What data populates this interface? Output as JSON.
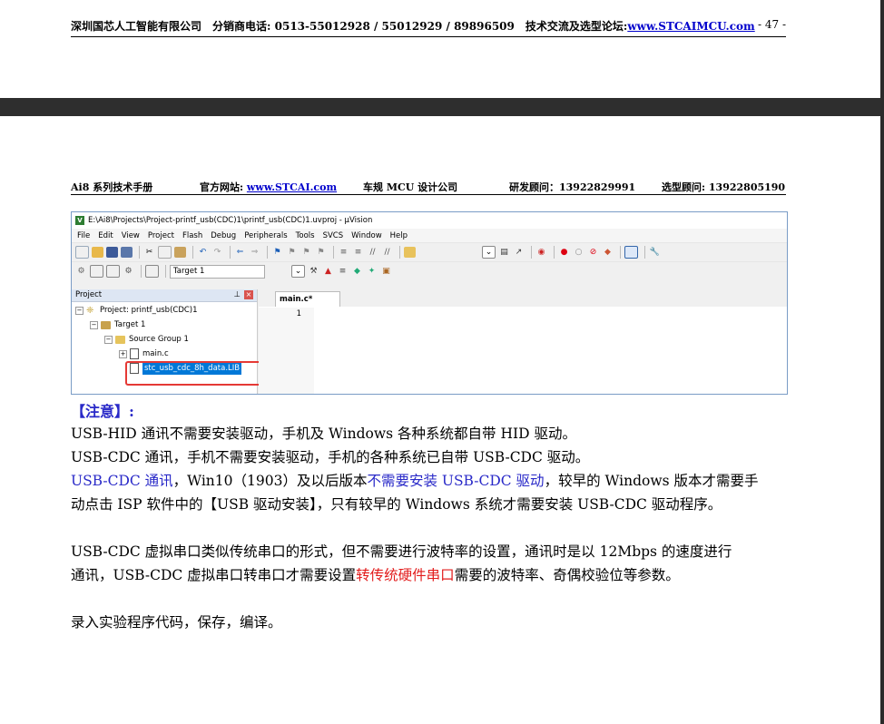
{
  "header1": {
    "company": "深圳国芯人工智能有限公司",
    "phone_label": "分销商电话: 0513-55012928 / 55012929 / 89896509",
    "forum_label": "技术交流及选型论坛:",
    "forum_url": "www.STCAIMCU.com",
    "page": "- 47 -"
  },
  "header2": {
    "manual": "Ai8 系列技术手册",
    "site_label": "官方网站: ",
    "site_url": "www.STCAI.com",
    "slogan": "车规 MCU 设计公司",
    "consultant": "研发顾问：13922829991",
    "selection": "选型顾问: 13922805190"
  },
  "uvision": {
    "title": "E:\\Ai8\\Projects\\Project-printf_usb(CDC)1\\printf_usb(CDC)1.uvproj - µVision",
    "menu": [
      "File",
      "Edit",
      "View",
      "Project",
      "Flash",
      "Debug",
      "Peripherals",
      "Tools",
      "SVCS",
      "Window",
      "Help"
    ],
    "target_combo": "Target 1",
    "panel_title": "Project",
    "tree": {
      "project": "Project: printf_usb(CDC)1",
      "target": "Target 1",
      "group": "Source Group 1",
      "file1": "main.c",
      "file2": "stc_usb_cdc_8h_data.LIB"
    },
    "tab": "main.c*",
    "line_no": "1"
  },
  "note": {
    "heading": "【注意】:",
    "line1": "USB-HID 通讯不需要安装驱动，手机及 Windows 各种系统都自带 HID 驱动。",
    "line2": "USB-CDC 通讯，手机不需要安装驱动，手机的各种系统已自带 USB-CDC 驱动。",
    "line3a": "USB-CDC 通讯",
    "line3b": "，Win10（1903）及以后版本",
    "line3c": "不需要安装 USB-CDC 驱动",
    "line3d": "，较早的 Windows 版本才需要手",
    "line4": "动点击 ISP 软件中的【USB 驱动安装】，只有较早的 Windows 系统才需要安装 USB-CDC 驱动程序。",
    "line5": "USB-CDC 虚拟串口类似传统串口的形式，但不需要进行波特率的设置，通讯时是以 12Mbps 的速度进行",
    "line6a": "通讯，USB-CDC 虚拟串口转串口才需要设置",
    "line6b": "转传统硬件串口",
    "line6c": "需要的波特率、奇偶校验位等参数。",
    "line7": "录入实验程序代码，保存，编译。"
  }
}
